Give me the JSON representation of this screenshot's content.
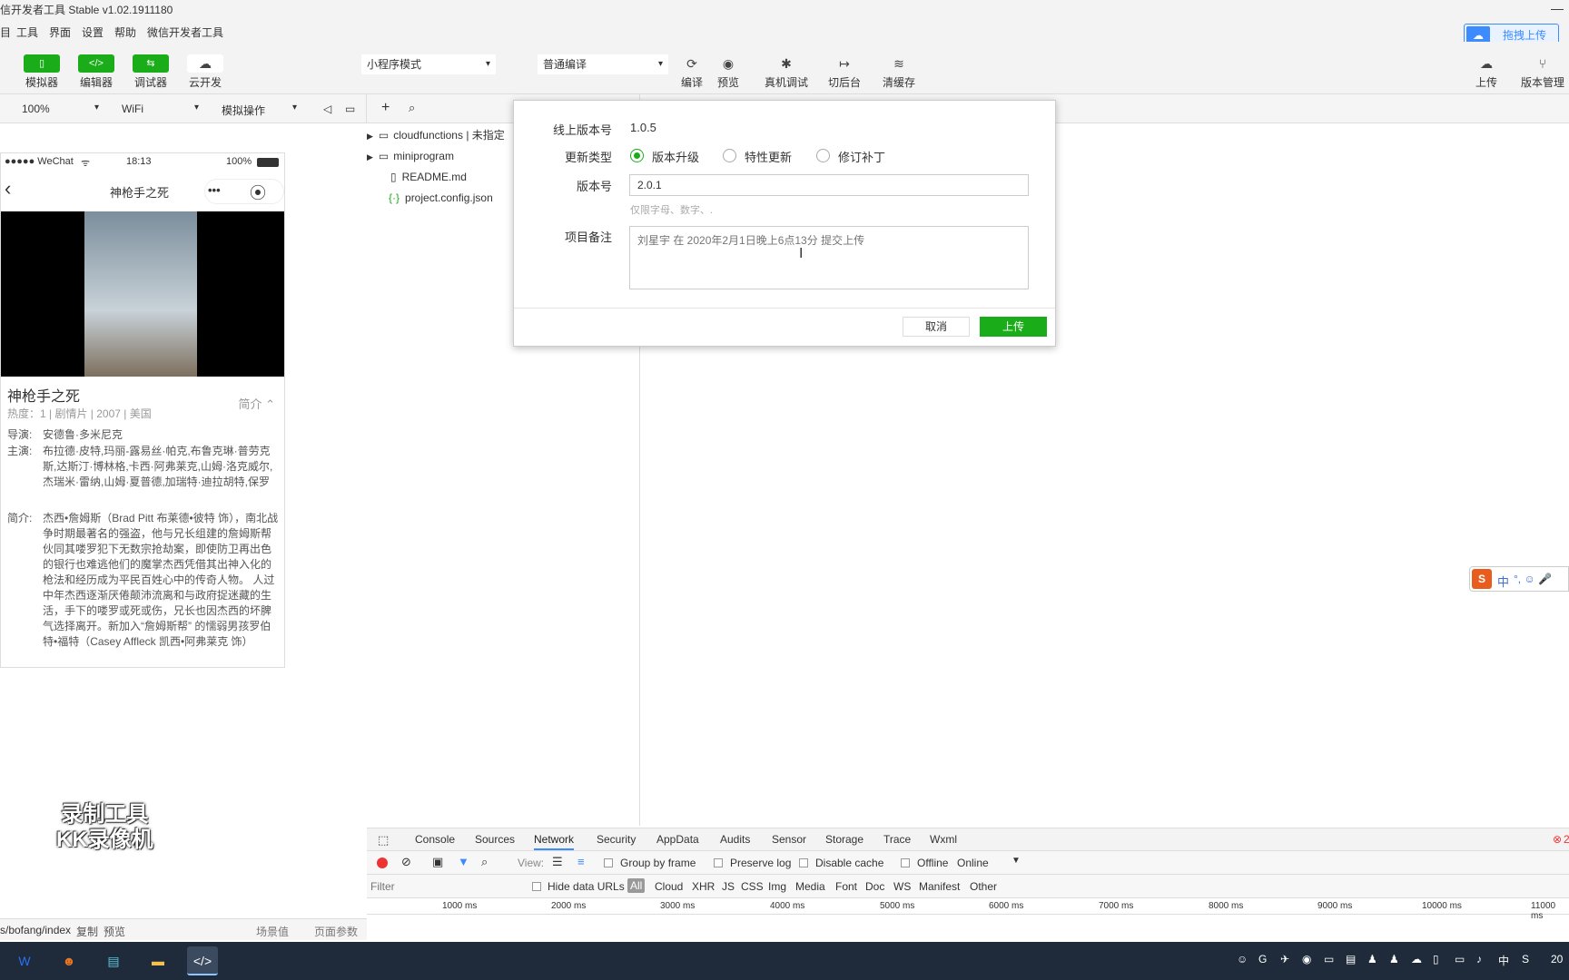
{
  "window": {
    "title": "信开发者工具 Stable v1.02.1911180",
    "minimize": "—"
  },
  "menu": [
    "目",
    "工具",
    "界面",
    "设置",
    "帮助",
    "微信开发者工具"
  ],
  "toolbar": {
    "left": [
      {
        "label": "模拟器",
        "glyph": "▯",
        "icon": "phone-icon"
      },
      {
        "label": "编辑器",
        "glyph": "</>",
        "icon": "code-icon"
      },
      {
        "label": "调试器",
        "glyph": "⇆",
        "icon": "debug-icon"
      },
      {
        "label": "云开发",
        "glyph": "☁",
        "icon": "cloud-icon"
      }
    ],
    "mode_select": "小程序模式",
    "compile_select": "普通编译",
    "center": [
      {
        "label": "编译",
        "glyph": "⟳",
        "icon": "refresh-icon"
      },
      {
        "label": "预览",
        "glyph": "◉",
        "icon": "eye-icon"
      },
      {
        "label": "真机调试",
        "glyph": "✱",
        "icon": "bug-icon"
      },
      {
        "label": "切后台",
        "glyph": "↦",
        "icon": "switch-icon"
      },
      {
        "label": "清缓存",
        "glyph": "≋",
        "icon": "layers-icon"
      }
    ],
    "right": [
      {
        "label": "上传",
        "glyph": "☁",
        "icon": "upload-icon"
      },
      {
        "label": "版本管理",
        "glyph": "⑂",
        "icon": "branch-icon"
      }
    ],
    "cloud_upload": "拖拽上传"
  },
  "subbar": {
    "zoom": "100%",
    "network": "WiFi",
    "sim_ops": "模拟操作"
  },
  "phone": {
    "carrier": "●●●●● WeChat",
    "wifi": "ᯤ",
    "time": "18:13",
    "battery": "100%",
    "nav_title": "神枪手之死",
    "back": "‹",
    "more": "•••",
    "record": "⦿",
    "movie_title": "神枪手之死",
    "meta": "热度：1 | 剧情片 | 2007 | 美国",
    "brief_toggle": "简介 ⌃",
    "director_label": "导演:",
    "director": "安德鲁·多米尼克",
    "cast_label": "主演:",
    "cast": "布拉德·皮特,玛丽-露易丝·帕克,布鲁克琳·普劳克斯,达斯汀·博林格,卡西·阿弗莱克,山姆·洛克威尔,杰瑞米·雷纳,山姆·夏普德,加瑞特·迪拉胡特,保罗",
    "intro_label": "简介:",
    "intro": "杰西•詹姆斯（Brad Pitt 布莱德•彼特 饰），南北战争时期最著名的强盗，他与兄长组建的詹姆斯帮伙同其喽罗犯下无数宗抢劫案，即使防卫再出色的银行也难逃他们的魔掌杰西凭借其出神入化的枪法和经历成为平民百姓心中的传奇人物。 人过中年杰西逐渐厌倦颠沛流离和与政府捉迷藏的生活，手下的喽罗或死或伤，兄长也因杰西的坏脾气选择离开。新加入“詹姆斯帮” 的懦弱男孩罗伯特•福特（Casey Affleck 凯西•阿弗莱克 饰）"
  },
  "files": [
    {
      "name": "cloudfunctions | 未指定",
      "type": "folder"
    },
    {
      "name": "miniprogram",
      "type": "folder"
    },
    {
      "name": "README.md",
      "type": "file"
    },
    {
      "name": "project.config.json",
      "type": "json"
    }
  ],
  "dialog": {
    "online_version_label": "线上版本号",
    "online_version": "1.0.5",
    "update_type_label": "更新类型",
    "update_types": [
      {
        "label": "版本升级",
        "checked": true
      },
      {
        "label": "特性更新",
        "checked": false
      },
      {
        "label": "修订补丁",
        "checked": false
      }
    ],
    "version_label": "版本号",
    "version_value": "2.0.1",
    "version_hint": "仅限字母、数字、.",
    "note_label": "项目备注",
    "note_placeholder": "刘星宇 在 2020年2月1日晚上6点13分 提交上传",
    "cancel": "取消",
    "upload": "上传"
  },
  "devtools": {
    "tabs": [
      "Console",
      "Sources",
      "Network",
      "Security",
      "AppData",
      "Audits",
      "Sensor",
      "Storage",
      "Trace",
      "Wxml"
    ],
    "active_tab": "Network",
    "error_count": "2",
    "controls": {
      "view": "View:",
      "group_by_frame": "Group by frame",
      "preserve_log": "Preserve log",
      "disable_cache": "Disable cache",
      "offline": "Offline",
      "throttle": "Online"
    },
    "filter_placeholder": "Filter",
    "hide_data_urls": "Hide data URLs",
    "types": [
      "All",
      "Cloud",
      "XHR",
      "JS",
      "CSS",
      "Img",
      "Media",
      "Font",
      "Doc",
      "WS",
      "Manifest",
      "Other"
    ],
    "timeline": [
      "1000 ms",
      "2000 ms",
      "3000 ms",
      "4000 ms",
      "5000 ms",
      "6000 ms",
      "7000 ms",
      "8000 ms",
      "9000 ms",
      "10000 ms",
      "11000 ms"
    ]
  },
  "bottom_bar": {
    "path": "s/bofang/index",
    "copy": "复制",
    "preview": "预览",
    "scene": "场景值",
    "params": "页面参数"
  },
  "watermark": {
    "line1": "录制工具",
    "line2": "KK录像机"
  },
  "ime": {
    "logo": "S",
    "lang": "中",
    "items": "°, ☺ 🎤"
  },
  "taskbar": {
    "apps": [
      {
        "glyph": "W",
        "icon": "wps-icon",
        "color": "#2a6ff3"
      },
      {
        "glyph": "☻",
        "icon": "qq-browser-icon",
        "color": "#e87722"
      },
      {
        "glyph": "▤",
        "icon": "notes-icon",
        "color": "#5cc2d8"
      },
      {
        "glyph": "▬",
        "icon": "explorer-icon",
        "color": "#f2c14e"
      },
      {
        "glyph": "</>",
        "icon": "wechat-devtools-icon",
        "color": "#1aad19"
      }
    ],
    "tray": [
      "☺",
      "G",
      "✈",
      "◉",
      "▭",
      "▤",
      "♟",
      "♟",
      "☁",
      "▯",
      "▭",
      "♪",
      "中",
      "S",
      "20"
    ],
    "accent": "#1aad19"
  }
}
